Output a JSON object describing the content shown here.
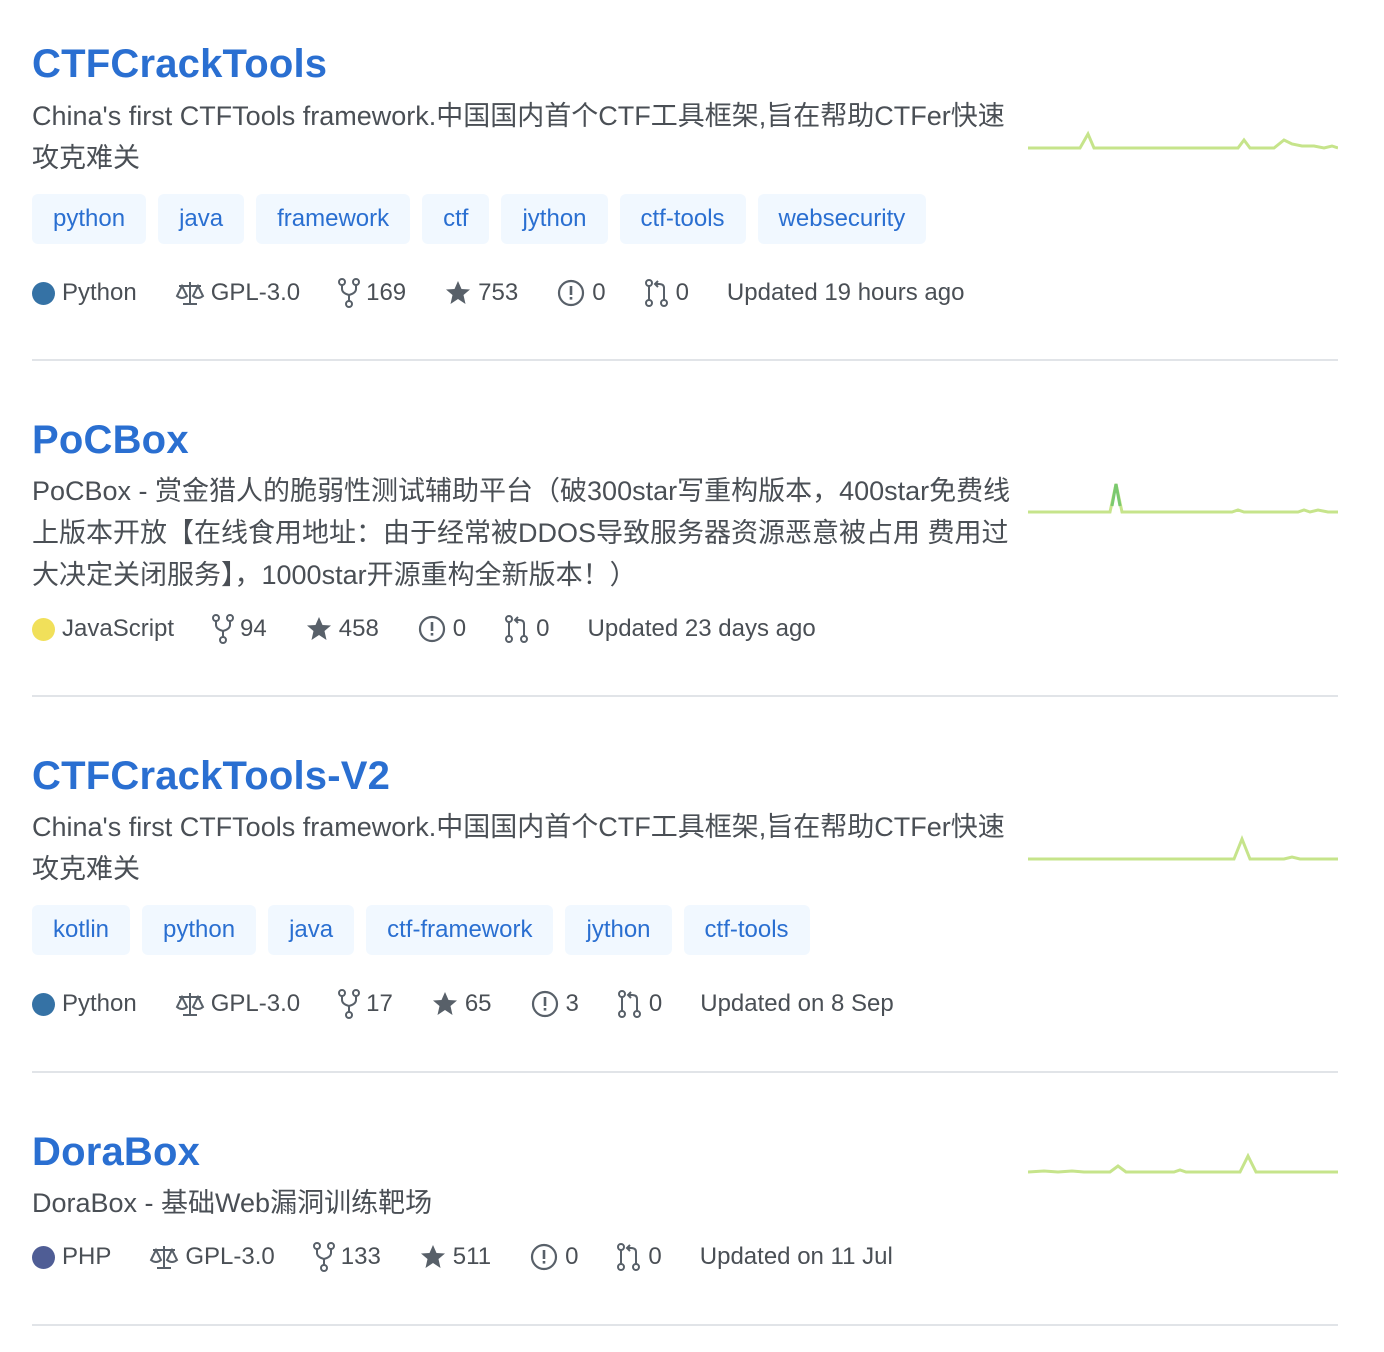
{
  "colors": {
    "link": "#2a6fd1",
    "topic_bg": "#f1f8ff",
    "spark_line": "#c6e48b",
    "spark_peak": "#7bc96f",
    "python": "#3572A5",
    "javascript": "#f1e05a",
    "php": "#4F5D95"
  },
  "labels": {
    "updated_prefix_ago": "Updated",
    "icons": {
      "license": "law-icon",
      "forks": "repo-forked-icon",
      "stars": "star-icon",
      "issues": "issue-opened-icon",
      "prs": "git-pull-request-icon"
    }
  },
  "repos": [
    {
      "name": "CTFCrackTools",
      "description": "China's first CTFTools framework.中国国内首个CTF工具框架,旨在帮助CTFer快速攻克难关",
      "topics": [
        "python",
        "java",
        "framework",
        "ctf",
        "jython",
        "ctf-tools",
        "websecurity"
      ],
      "language": "Python",
      "language_color": "#3572A5",
      "license": "GPL-3.0",
      "forks": "169",
      "stars": "753",
      "issues": "0",
      "prs": "0",
      "updated": "Updated 19 hours ago"
    },
    {
      "name": "PoCBox",
      "description": "PoCBox - 赏金猎人的脆弱性测试辅助平台（破300star写重构版本，400star免费线上版本开放【在线食用地址：由于经常被DDOS导致服务器资源恶意被占用 费用过大决定关闭服务】，1000star开源重构全新版本！）",
      "topics": [],
      "language": "JavaScript",
      "language_color": "#f1e05a",
      "license": "",
      "forks": "94",
      "stars": "458",
      "issues": "0",
      "prs": "0",
      "updated": "Updated 23 days ago"
    },
    {
      "name": "CTFCrackTools-V2",
      "description": "China's first CTFTools framework.中国国内首个CTF工具框架,旨在帮助CTFer快速攻克难关",
      "topics": [
        "kotlin",
        "python",
        "java",
        "ctf-framework",
        "jython",
        "ctf-tools"
      ],
      "language": "Python",
      "language_color": "#3572A5",
      "license": "GPL-3.0",
      "forks": "17",
      "stars": "65",
      "issues": "3",
      "prs": "0",
      "updated": "Updated on 8 Sep"
    },
    {
      "name": "DoraBox",
      "description": "DoraBox - 基础Web漏洞训练靶场",
      "topics": [],
      "language": "PHP",
      "language_color": "#4F5D95",
      "license": "GPL-3.0",
      "forks": "133",
      "stars": "511",
      "issues": "0",
      "prs": "0",
      "updated": "Updated on 11 Jul"
    }
  ]
}
